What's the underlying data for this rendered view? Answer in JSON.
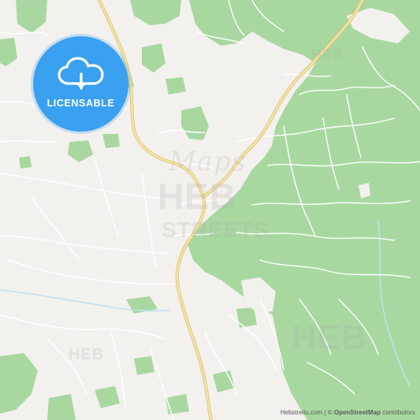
{
  "map": {
    "colors": {
      "land": "#f3f1ee",
      "forest": "#a8d8a0",
      "road_major": "#f4e3a2",
      "road_major_casing": "#d9c27a",
      "road_minor": "#ffffff",
      "water": "#bfe0f2",
      "badge": "#3aa0f0"
    }
  },
  "badge": {
    "label": "LICENSABLE",
    "icon": "cloud-download-icon"
  },
  "watermarks": {
    "heb": "HEB",
    "streets": "STREETS",
    "maps": "Maps",
    "heb_small": "HEB",
    "heb_bottom_left": "HEB",
    "heb_bottom_right": "HEB"
  },
  "attribution": {
    "site": "Hebstreits.com",
    "separator": " | © ",
    "osm": "OpenStreetMap",
    "suffix": " contributors"
  }
}
